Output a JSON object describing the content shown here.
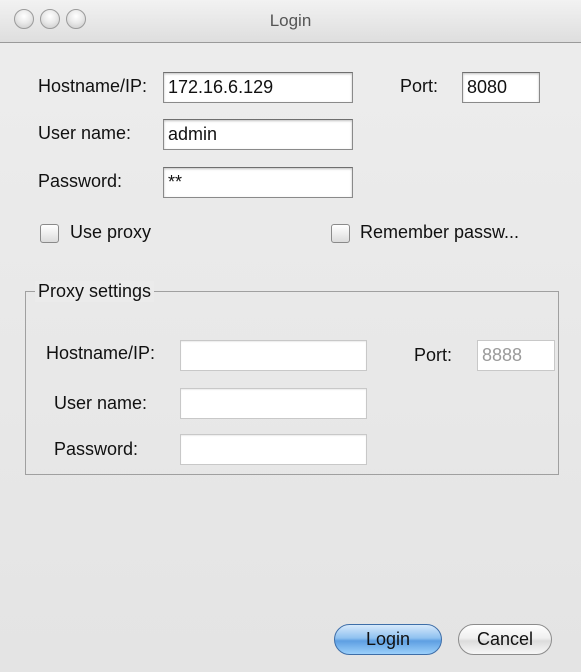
{
  "window": {
    "title": "Login"
  },
  "login": {
    "hostname_label": "Hostname/IP:",
    "hostname_value": "172.16.6.129",
    "port_label": "Port:",
    "port_value": "8080",
    "username_label": "User name:",
    "username_value": "admin",
    "password_label": "Password:",
    "password_value": "**"
  },
  "options": {
    "use_proxy_label": "Use proxy",
    "use_proxy_checked": false,
    "remember_label": "Remember passw...",
    "remember_checked": false
  },
  "proxy": {
    "group_title": "Proxy settings",
    "hostname_label": "Hostname/IP:",
    "hostname_value": "",
    "port_label": "Port:",
    "port_value": "8888",
    "username_label": "User name:",
    "username_value": "",
    "password_label": "Password:",
    "password_value": ""
  },
  "buttons": {
    "login": "Login",
    "cancel": "Cancel"
  }
}
